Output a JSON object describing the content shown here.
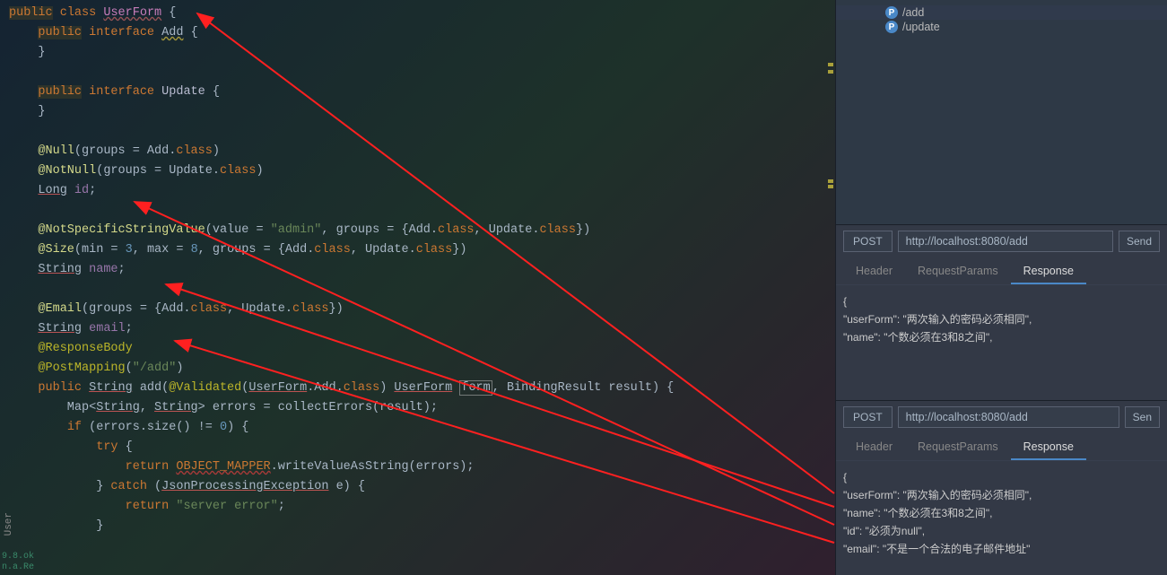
{
  "code": {
    "l1": "public class UserForm {",
    "l2": "    public interface Add {",
    "l3": "    }",
    "l4": "",
    "l5": "    public interface Update {",
    "l6": "    }",
    "l7": "",
    "l8": "    @Null(groups = Add.class)",
    "l9": "    @NotNull(groups = Update.class)",
    "l10": "    Long id;",
    "l11": "",
    "l12": "    @NotSpecificStringValue(value = \"admin\", groups = {Add.class, Update.class})",
    "l13": "    @Size(min = 3, max = 8, groups = {Add.class, Update.class})",
    "l14": "    String name;",
    "l15": "",
    "l16": "    @Email(groups = {Add.class, Update.class})",
    "l17": "    String email;",
    "l18": "    @ResponseBody",
    "l19": "    @PostMapping(\"/add\")",
    "l20": "    public String add(@Validated(UserForm.Add.class) UserForm form, BindingResult result) {",
    "l21": "        Map<String, String> errors = collectErrors(result);",
    "l22": "        if (errors.size() != 0) {",
    "l23": "            try {",
    "l24": "                return OBJECT_MAPPER.writeValueAsString(errors);",
    "l25": "            } catch (JsonProcessingException e) {",
    "l26": "                return \"server error\";",
    "l27": "            }"
  },
  "tree": {
    "items": [
      {
        "label": "/add",
        "selected": true
      },
      {
        "label": "/update",
        "selected": false
      }
    ]
  },
  "http1": {
    "method": "POST",
    "url": "http://localhost:8080/add",
    "send": "Send",
    "tabs": [
      "Header",
      "RequestParams",
      "Response"
    ],
    "response": {
      "lines": [
        "{",
        "  \"userForm\": \"两次输入的密码必须相同\",",
        "  \"name\": \"个数必须在3和8之间\","
      ]
    }
  },
  "http2": {
    "method": "POST",
    "url": "http://localhost:8080/add",
    "send": "Sen",
    "tabs": [
      "Header",
      "RequestParams",
      "Response"
    ],
    "response": {
      "lines": [
        "{",
        "  \"userForm\": \"两次输入的密码必须相同\",",
        "  \"name\": \"个数必须在3和8之间\",",
        "  \"id\": \"必须为null\",",
        "  \"email\": \"不是一个合法的电子邮件地址\""
      ]
    }
  },
  "leftTab": "User",
  "leftBottom": [
    "9.8.ok",
    "n.a.Re"
  ]
}
